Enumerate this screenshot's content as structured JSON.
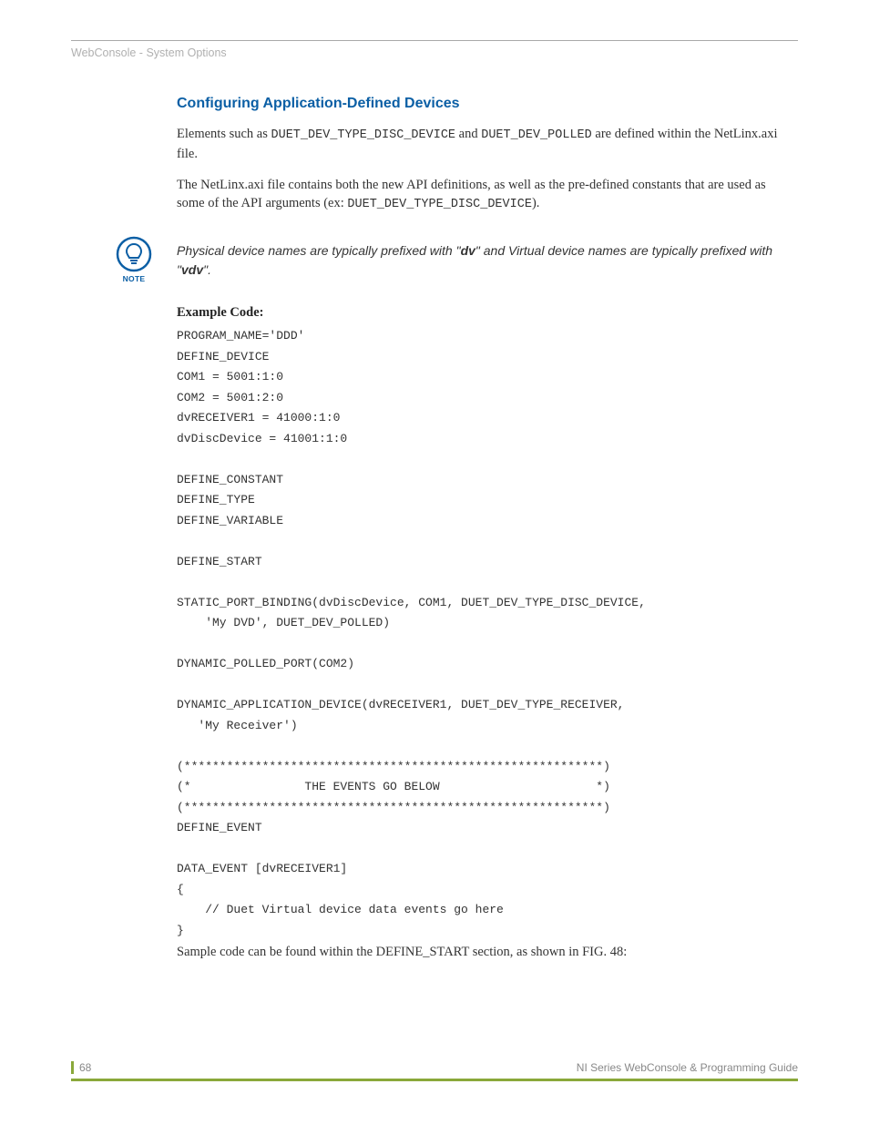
{
  "breadcrumb": "WebConsole - System Options",
  "heading": "Configuring Application-Defined Devices",
  "para1_a": "Elements such as ",
  "para1_code1": "DUET_DEV_TYPE_DISC_DEVICE",
  "para1_b": " and ",
  "para1_code2": "DUET_DEV_POLLED",
  "para1_c": " are defined within the NetLinx.axi file.",
  "para2_a": "The NetLinx.axi file contains both the new API definitions, as well as the pre-defined constants that are used as some of the API arguments (ex: ",
  "para2_code1": "DUET_DEV_TYPE_DISC_DEVICE",
  "para2_b": ").",
  "note_label": "NOTE",
  "note_a": "Physical device names are typically prefixed with \"",
  "note_b1": "dv",
  "note_c": "\" and Virtual device names are typically prefixed with \"",
  "note_b2": "vdv",
  "note_d": "\".",
  "example_head": "Example Code:",
  "code": "PROGRAM_NAME='DDD'\nDEFINE_DEVICE\nCOM1 = 5001:1:0\nCOM2 = 5001:2:0\ndvRECEIVER1 = 41000:1:0\ndvDiscDevice = 41001:1:0\n\nDEFINE_CONSTANT\nDEFINE_TYPE\nDEFINE_VARIABLE\n\nDEFINE_START\n\nSTATIC_PORT_BINDING(dvDiscDevice, COM1, DUET_DEV_TYPE_DISC_DEVICE,\n    'My DVD', DUET_DEV_POLLED)\n\nDYNAMIC_POLLED_PORT(COM2)\n\nDYNAMIC_APPLICATION_DEVICE(dvRECEIVER1, DUET_DEV_TYPE_RECEIVER,\n   'My Receiver')\n\n(***********************************************************)\n(*                THE EVENTS GO BELOW                      *)\n(***********************************************************)\nDEFINE_EVENT\n\nDATA_EVENT [dvRECEIVER1]\n{\n    // Duet Virtual device data events go here\n}",
  "closing": "Sample code can be found within the DEFINE_START section, as shown in FIG. 48:",
  "page_num": "68",
  "footer_right": "NI Series WebConsole & Programming Guide"
}
